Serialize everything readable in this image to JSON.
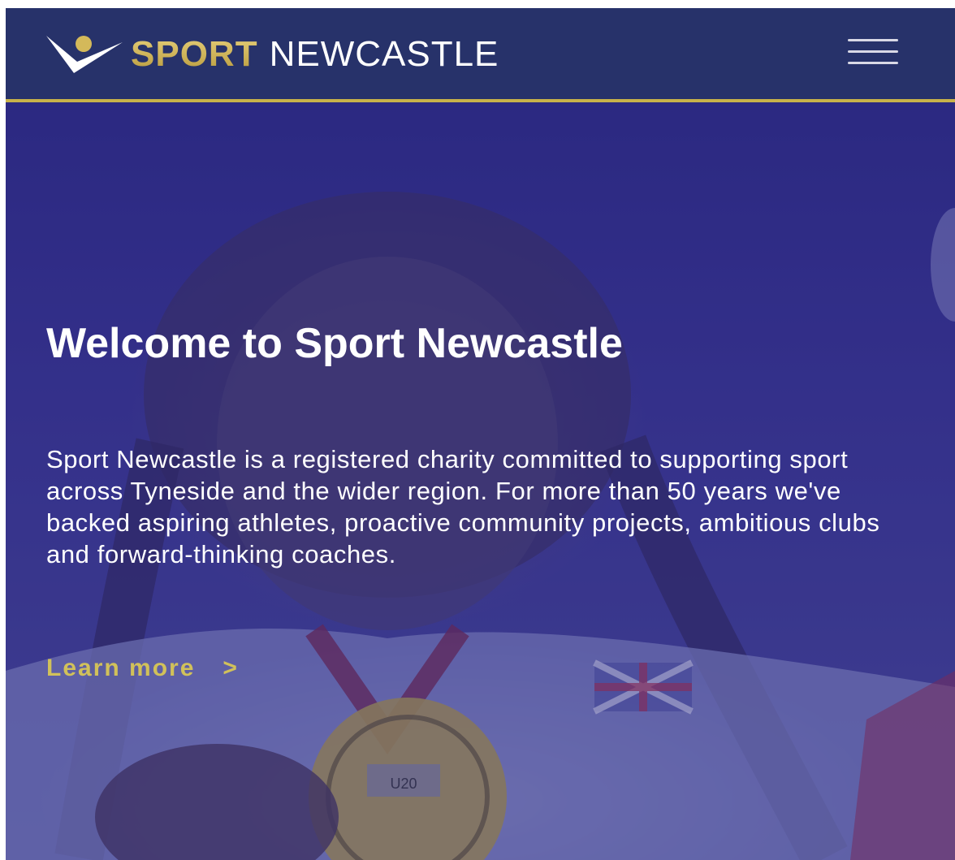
{
  "header": {
    "logo_sport": "SPORT",
    "logo_newcastle": "NEWCASTLE",
    "menu_icon": "hamburger-menu-icon"
  },
  "hero": {
    "title": "Welcome to Sport Newcastle",
    "description": "Sport Newcastle is a registered charity committed to supporting sport across Tyneside and the wider region. For more than 50 years we've backed aspiring athletes, proactive community projects, ambitious clubs and forward-thinking coaches.",
    "cta_label": "Learn more",
    "cta_icon": "chevron-right-icon",
    "medal_text": "U20"
  },
  "colors": {
    "header_bg": "#27326a",
    "accent_gold": "#c8b24a",
    "hero_overlay": "#2e2b82",
    "cta_text": "#d1c15a"
  }
}
